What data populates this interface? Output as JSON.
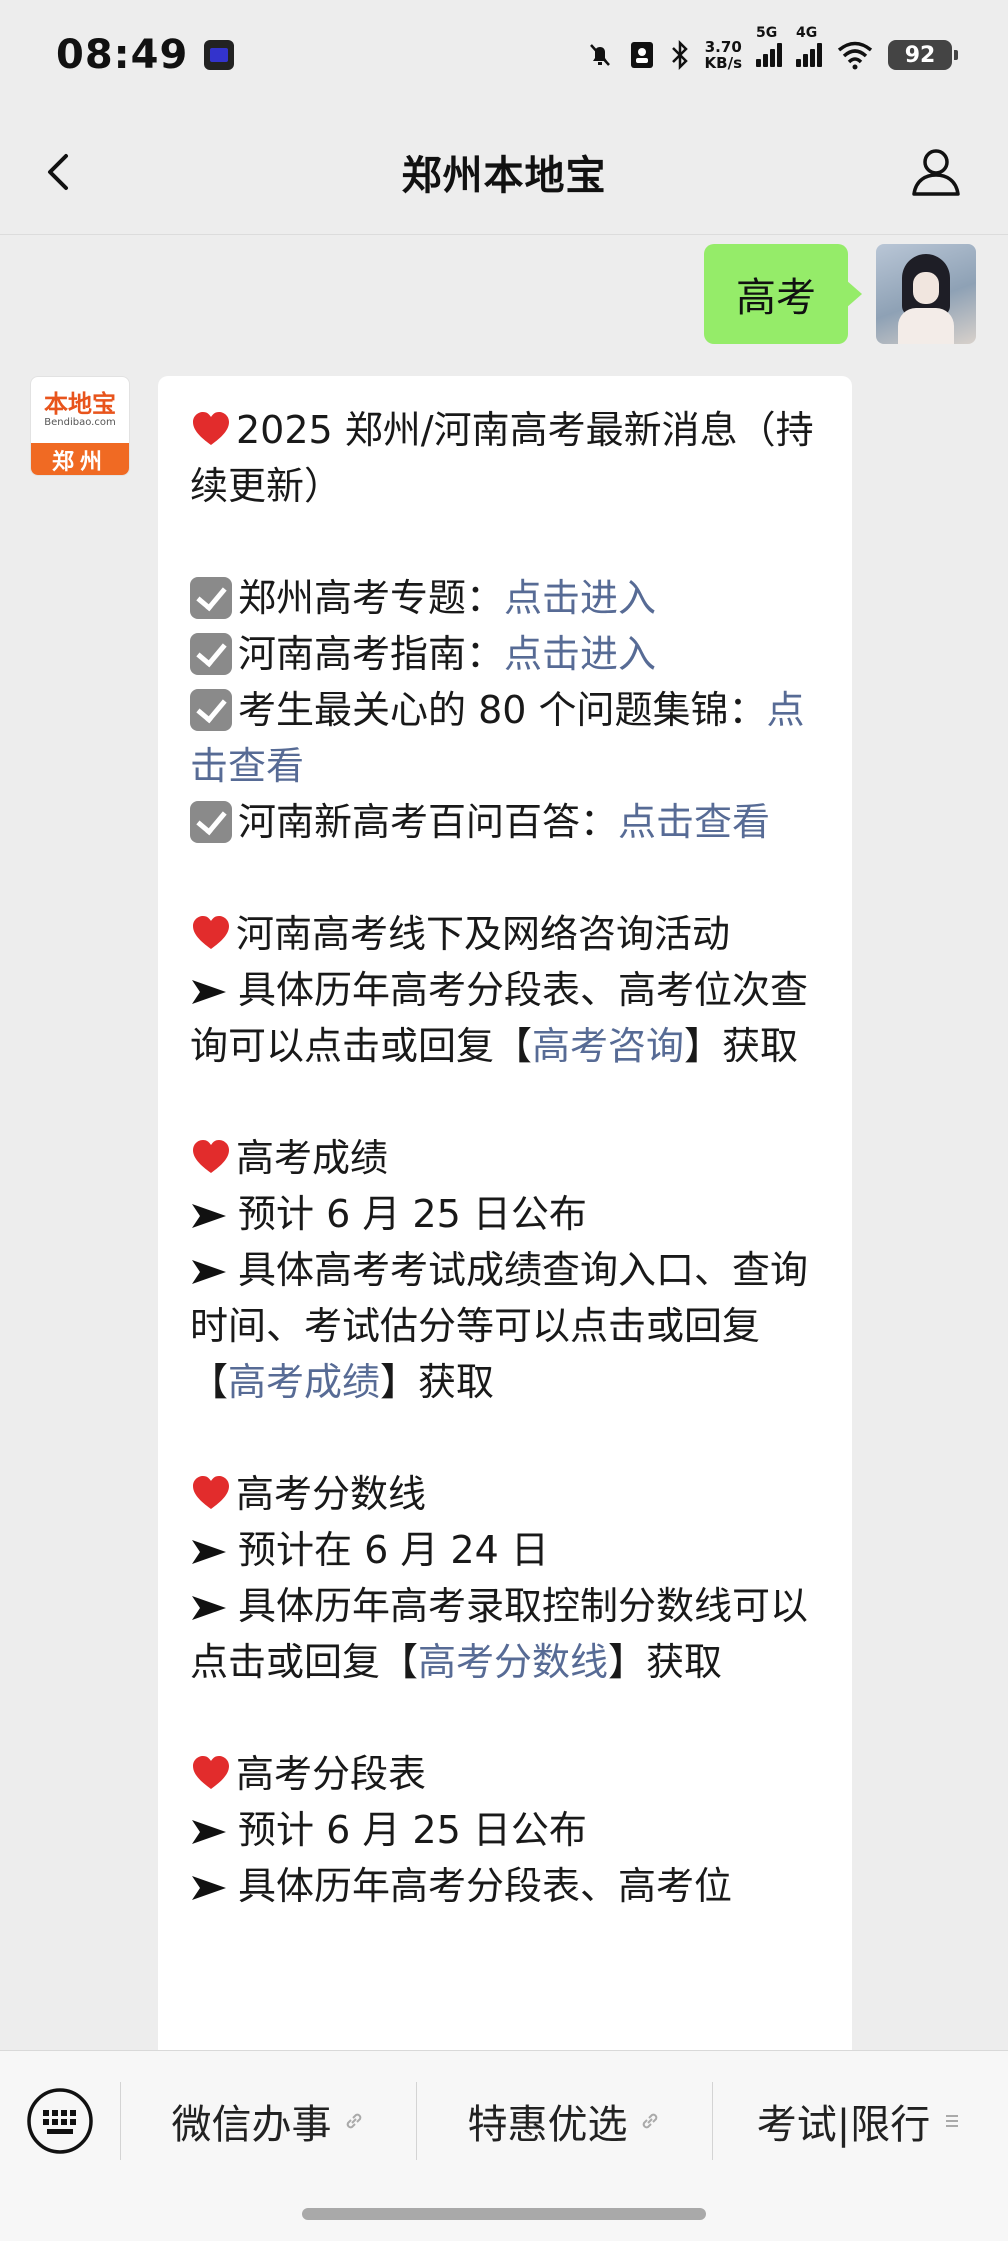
{
  "status_bar": {
    "time": "08:49",
    "network_speed_value": "3.70",
    "network_speed_unit": "KB/s",
    "network_1": "5G",
    "network_2": "4G",
    "battery": "92"
  },
  "header": {
    "title": "郑州本地宝"
  },
  "conversation": {
    "user_message": "高考",
    "bot_name": "郑州本地宝",
    "bot_logo_text": "本地宝",
    "bot_logo_subtext": "Bendibao.com",
    "bot_logo_city": "郑州",
    "reply": {
      "title": "2025 郑州/河南高考最新消息（持续更新）",
      "link_line_1_prefix": "郑州高考专题：",
      "link_line_1_link": "点击进入",
      "link_line_2_prefix": "河南高考指南：",
      "link_line_2_link": "点击进入",
      "link_line_3_prefix": "考生最关心的 80 个问题集锦：",
      "link_line_3_link": "点击查看",
      "link_line_4_prefix": "河南新高考百问百答：",
      "link_line_4_link": "点击查看",
      "section_1_title": "河南高考线下及网络咨询活动",
      "section_1_text_prefix": "具体历年高考分段表、高考位次查询可以点击或回复【",
      "section_1_link": "高考咨询",
      "section_1_text_suffix": "】获取",
      "section_2_title": "高考成绩",
      "section_2_line_1": "预计 6 月 25 日公布",
      "section_2_text_prefix": "具体高考考试成绩查询入口、查询时间、考试估分等可以点击或回复【",
      "section_2_link": "高考成绩",
      "section_2_text_suffix": "】获取",
      "section_3_title": "高考分数线",
      "section_3_line_1": "预计在 6 月 24 日",
      "section_3_text_prefix": "具体历年高考录取控制分数线可以点击或回复【",
      "section_3_link": "高考分数线",
      "section_3_text_suffix": "】获取",
      "section_4_title": "高考分段表",
      "section_4_line_1": "预计 6 月 25 日公布",
      "section_4_line_2_partial": "具体历年高考分段表、高考位"
    }
  },
  "bottom_menu": {
    "items": [
      {
        "label": "微信办事",
        "icon": "link-icon"
      },
      {
        "label": "特惠优选",
        "icon": "link-icon"
      },
      {
        "label": "考试|限行",
        "icon": "menu-lines-icon"
      }
    ]
  },
  "colors": {
    "outgoing_bubble": "#95ec69",
    "incoming_bubble": "#ffffff",
    "link": "#576b95",
    "background": "#ededed",
    "logo_orange": "#f06a23"
  }
}
